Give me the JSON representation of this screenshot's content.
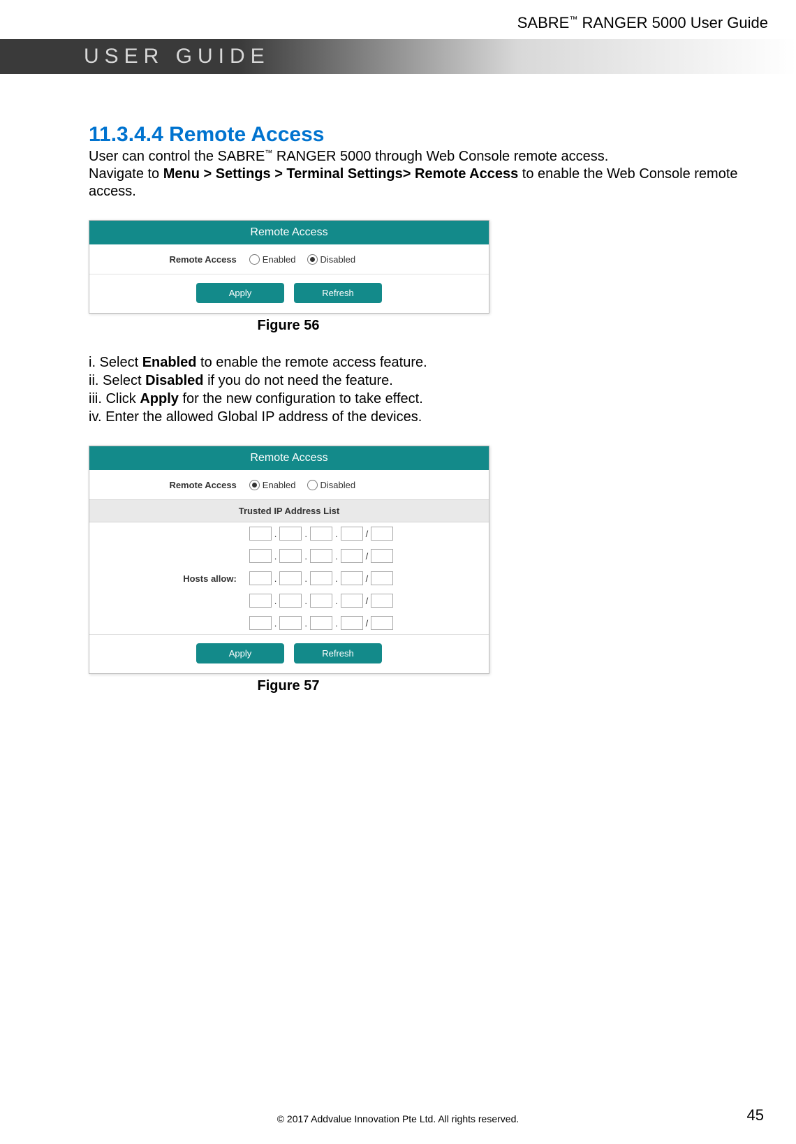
{
  "header": {
    "product_prefix": "SABRE",
    "tm": "™",
    "product_suffix": " RANGER 5000 User Guide"
  },
  "banner": {
    "text": "USER GUIDE"
  },
  "section": {
    "number": "11.3.4.4",
    "title": "Remote Access",
    "intro_pre": "User can control the SABRE",
    "intro_tm": "™",
    "intro_post": " RANGER 5000 through Web Console remote access.",
    "nav_prefix": "Navigate to ",
    "nav_bold": "Menu > Settings > Terminal Settings> Remote Access",
    "nav_suffix": " to enable the Web Console remote access."
  },
  "figure56": {
    "header": "Remote Access",
    "row_label": "Remote Access",
    "enabled": "Enabled",
    "disabled": "Disabled",
    "apply": "Apply",
    "refresh": "Refresh",
    "caption": "Figure 56"
  },
  "steps": {
    "s1_pre": "i. Select ",
    "s1_bold": "Enabled",
    "s1_post": " to enable the remote access feature.",
    "s2_pre": "ii. Select ",
    "s2_bold": "Disabled",
    "s2_post": " if you do not need the feature.",
    "s3_pre": "iii. Click ",
    "s3_bold": "Apply",
    "s3_post": " for the new configuration to take effect.",
    "s4": "iv. Enter the allowed Global IP address of the devices."
  },
  "figure57": {
    "header": "Remote Access",
    "row_label": "Remote Access",
    "enabled": "Enabled",
    "disabled": "Disabled",
    "trusted": "Trusted IP Address List",
    "hosts_label": "Hosts allow:",
    "sep_dot": ".",
    "sep_slash": "/",
    "apply": "Apply",
    "refresh": "Refresh",
    "caption": "Figure 57"
  },
  "footer": {
    "copyright": "© 2017 Addvalue Innovation Pte Ltd. All rights reserved.",
    "page": "45"
  }
}
